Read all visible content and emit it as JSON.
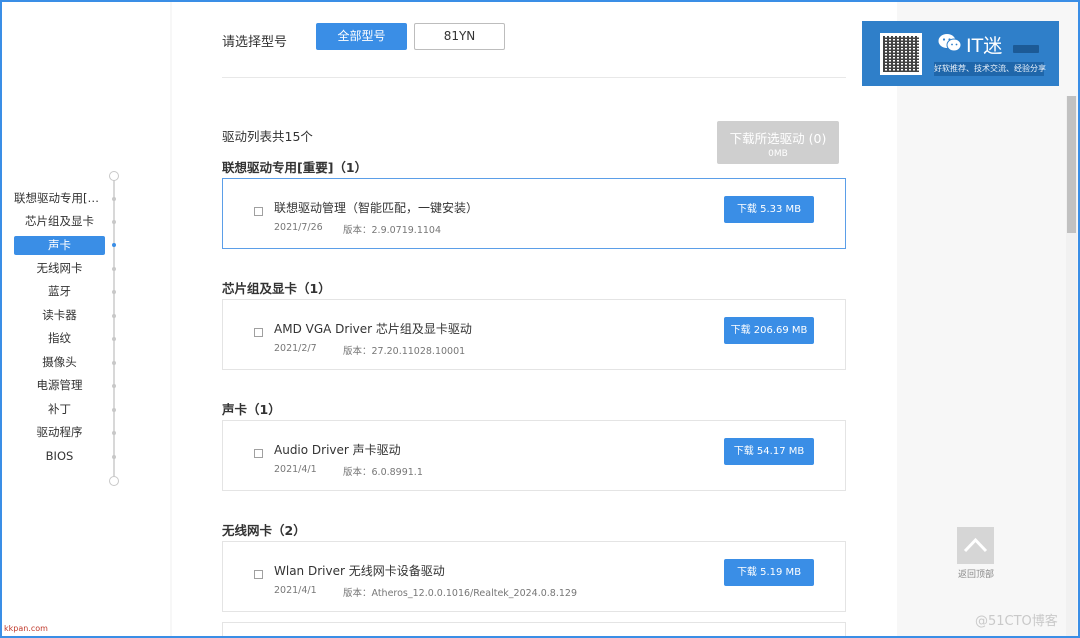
{
  "sidebar": {
    "items": [
      {
        "label": "联想驱动专用[重..."
      },
      {
        "label": "芯片组及显卡"
      },
      {
        "label": "声卡",
        "active": true
      },
      {
        "label": "无线网卡"
      },
      {
        "label": "蓝牙"
      },
      {
        "label": "读卡器"
      },
      {
        "label": "指纹"
      },
      {
        "label": "摄像头"
      },
      {
        "label": "电源管理"
      },
      {
        "label": "补丁"
      },
      {
        "label": "驱动程序"
      },
      {
        "label": "BIOS"
      }
    ]
  },
  "model": {
    "label": "请选择型号",
    "all_label": "全部型号",
    "current": "81YN"
  },
  "list": {
    "count_text": "驱动列表共15个",
    "download_selected": "下载所选驱动 (0)",
    "download_selected_size": "0MB"
  },
  "categories": [
    {
      "title": "联想驱动专用[重要]（1）",
      "driver": {
        "name": "联想驱动管理（智能匹配，一键安装）",
        "date": "2021/7/26",
        "version": "版本：2.9.0719.1104",
        "download": "下载 5.33 MB"
      }
    },
    {
      "title": "芯片组及显卡（1）",
      "driver": {
        "name": "AMD VGA Driver 芯片组及显卡驱动",
        "date": "2021/2/7",
        "version": "版本：27.20.11028.10001",
        "download": "下载 206.69 MB"
      }
    },
    {
      "title": "声卡（1）",
      "driver": {
        "name": "Audio Driver 声卡驱动",
        "date": "2021/4/1",
        "version": "版本：6.0.8991.1",
        "download": "下载 54.17 MB"
      }
    },
    {
      "title": "无线网卡（2）",
      "driver": {
        "name": "Wlan Driver 无线网卡设备驱动",
        "date": "2021/4/1",
        "version": "版本：Atheros_12.0.0.1016/Realtek_2024.0.8.129",
        "download": "下载 5.19 MB"
      }
    }
  ],
  "banner": {
    "title": "IT迷",
    "subtitle": "好软推荐、技术交流、经验分享",
    "icons": [
      "qr-code-icon",
      "wechat-icon"
    ]
  },
  "back_to_top": {
    "label": "返回顶部",
    "icon": "chevron-up-icon"
  },
  "watermark": {
    "right": "@51CTO博客",
    "left": "kkpan.com"
  },
  "colors": {
    "accent": "#3a8ee6",
    "disabled": "#cfcfcf",
    "banner": "#2f7fc9"
  }
}
